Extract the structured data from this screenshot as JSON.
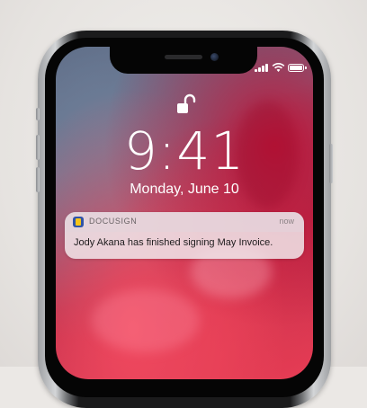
{
  "lock_screen": {
    "time": "9:41",
    "date": "Monday, June 10",
    "lock_icon": "unlocked-padlock-icon"
  },
  "status_bar": {
    "signal_icon": "cellular-signal-icon",
    "wifi_icon": "wifi-icon",
    "battery_icon": "battery-icon"
  },
  "notification": {
    "app_name": "DOCUSIGN",
    "app_icon": "docusign-app-icon",
    "timestamp": "now",
    "message": "Jody Akana has finished signing May Invoice."
  },
  "colors": {
    "wallpaper_red": "#e23b52",
    "wallpaper_blue": "#6c7892",
    "notification_timestamp": "#8c8386"
  }
}
